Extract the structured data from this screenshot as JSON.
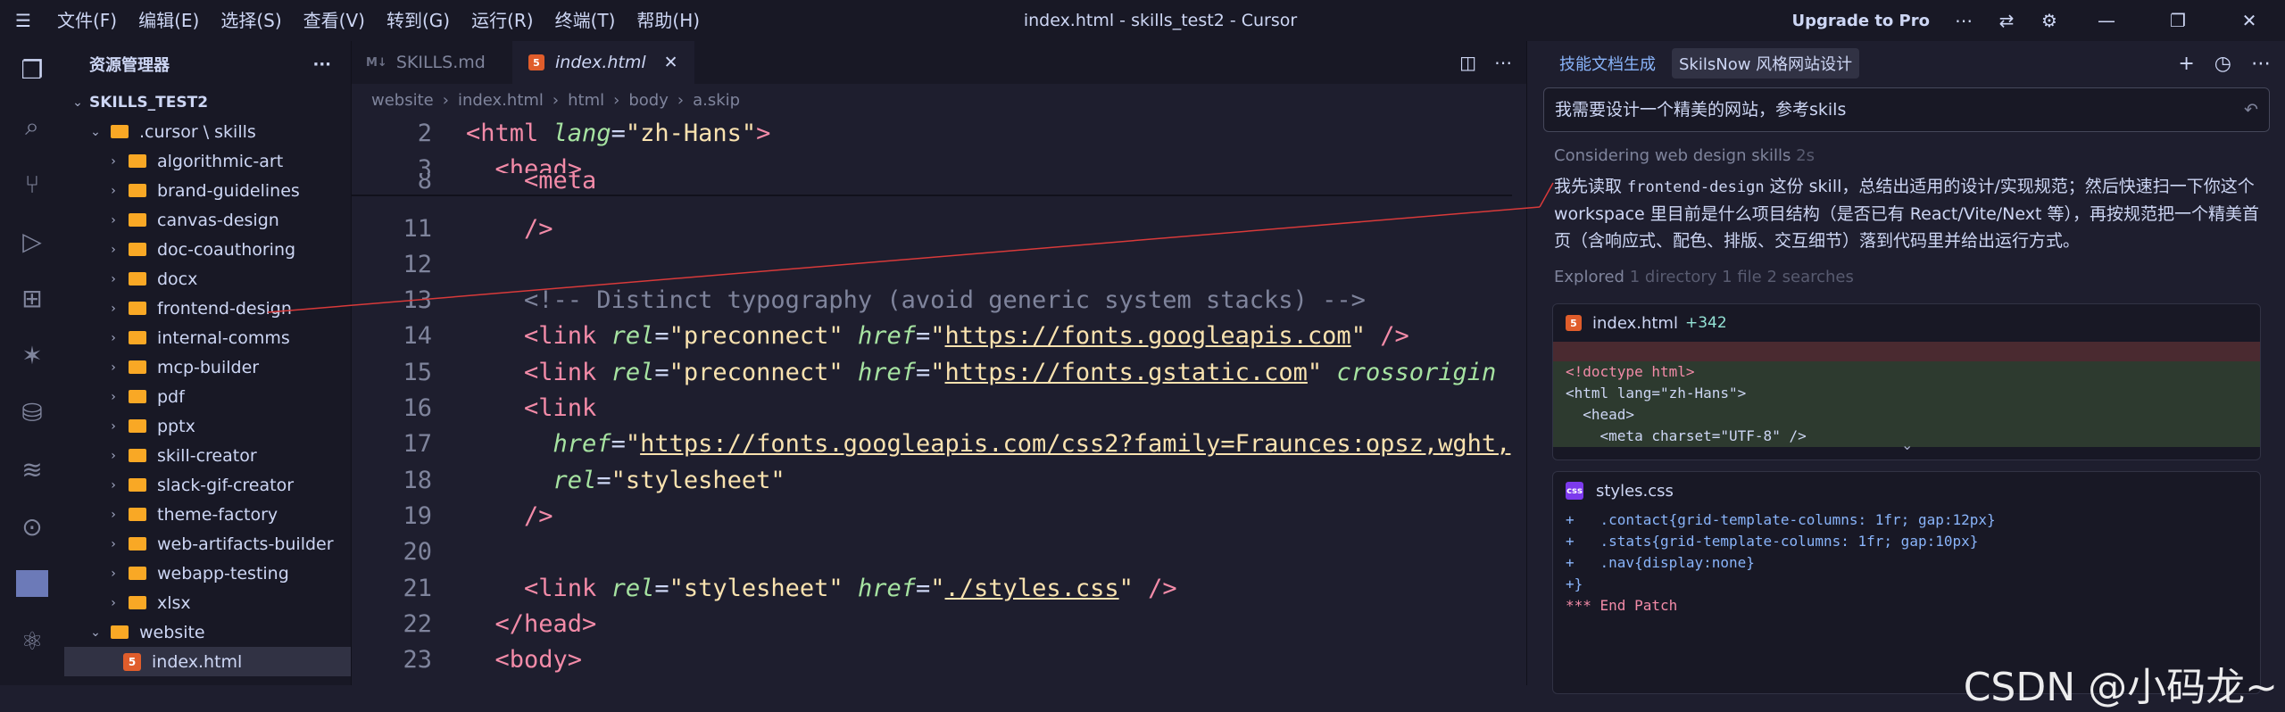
{
  "titlebar": {
    "menus": [
      "文件(F)",
      "编辑(E)",
      "选择(S)",
      "查看(V)",
      "转到(G)",
      "运行(R)",
      "终端(T)",
      "帮助(H)"
    ],
    "title": "index.html - skills_test2 - Cursor",
    "upgrade": "Upgrade to Pro"
  },
  "sidebar": {
    "title": "资源管理器",
    "more": "···",
    "root": "SKILLS_TEST2",
    "cursor_path": ".cursor \\ skills",
    "folders": [
      "algorithmic-art",
      "brand-guidelines",
      "canvas-design",
      "doc-coauthoring",
      "docx",
      "frontend-design",
      "internal-comms",
      "mcp-builder",
      "pdf",
      "pptx",
      "skill-creator",
      "slack-gif-creator",
      "theme-factory",
      "web-artifacts-builder",
      "webapp-testing",
      "xlsx"
    ],
    "website": "website",
    "file": "index.html"
  },
  "editor": {
    "tabs": [
      {
        "label": "SKILLS.md",
        "icon": "M↓"
      },
      {
        "label": "index.html",
        "icon": "5",
        "close": "✕"
      }
    ],
    "crumbs": [
      "website",
      "index.html",
      "html",
      "body",
      "a.skip"
    ],
    "lines": [
      {
        "n": "2",
        "html": "<span class='tg'>&lt;html</span> <span class='at'>lang</span><span class='pl'>=</span><span class='st'>\"zh-Hans\"</span><span class='tg'>&gt;</span>"
      },
      {
        "n": "3",
        "html": "  <span class='tg'>&lt;head&gt;</span>"
      },
      {
        "n": "11",
        "html": "    <span class='tg'>/&gt;</span>"
      },
      {
        "n": "12",
        "html": ""
      },
      {
        "n": "13",
        "html": "    <span class='cm'>&lt;!-- Distinct typography (avoid generic system stacks) --&gt;</span>"
      },
      {
        "n": "14",
        "html": "    <span class='tg'>&lt;link</span> <span class='at'>rel</span>=<span class='st'>\"preconnect\"</span> <span class='at'>href</span>=<span class='st'>\"<span class='ul'>https://fonts.googleapis.com</span>\"</span> <span class='tg'>/&gt;</span>"
      },
      {
        "n": "15",
        "html": "    <span class='tg'>&lt;link</span> <span class='at'>rel</span>=<span class='st'>\"preconnect\"</span> <span class='at'>href</span>=<span class='st'>\"<span class='ul'>https://fonts.gstatic.com</span>\"</span> <span class='at'>crossorigin</span>"
      },
      {
        "n": "16",
        "html": "    <span class='tg'>&lt;link</span>"
      },
      {
        "n": "17",
        "html": "      <span class='at'>href</span>=<span class='st'>\"<span class='ul'>https://fonts.googleapis.com/css2?family=Fraunces:opsz,wght,</span></span>"
      },
      {
        "n": "18",
        "html": "      <span class='at'>rel</span>=<span class='st'>\"stylesheet\"</span>"
      },
      {
        "n": "19",
        "html": "    <span class='tg'>/&gt;</span>"
      },
      {
        "n": "20",
        "html": ""
      },
      {
        "n": "21",
        "html": "    <span class='tg'>&lt;link</span> <span class='at'>rel</span>=<span class='st'>\"stylesheet\"</span> <span class='at'>href</span>=<span class='st'>\"<span class='ul'>./styles.css</span>\"</span> <span class='tg'>/&gt;</span>"
      },
      {
        "n": "22",
        "html": "  <span class='tg'>&lt;/head&gt;</span>"
      },
      {
        "n": "23",
        "html": "  <span class='tg'>&lt;body&gt;</span>"
      }
    ],
    "sticky_meta_n": "8",
    "sticky_meta": "    <meta"
  },
  "panel": {
    "tabs": [
      "技能文档生成",
      "SkilsNow 风格网站设计"
    ],
    "prompt": "我需要设计一个精美的网站，参考skils",
    "thinking": "Considering web design skills",
    "thinking_time": "2s",
    "message": "我先读取 <code>frontend-design</code> 这份 skill，总结出适用的设计/实现规范；然后快速扫一下你这个 workspace 里目前是什么项目结构（是否已有 React/Vite/Next 等），再按规范把一个精美首页（含响应式、配色、排版、交互细节）落到代码里并给出运行方式。",
    "explored": "Explored",
    "explored_detail": "1 directory 1 file 2 searches",
    "card1": {
      "name": "index.html",
      "delta": "+342",
      "lines": [
        "<!doctype html>",
        "<html lang=\"zh-Hans\">",
        "  <head>",
        "    <meta charset=\"UTF-8\" />"
      ]
    },
    "card2": {
      "name": "styles.css",
      "lines": [
        "+   .contact{grid-template-columns: 1fr; gap:12px}",
        "+   .stats{grid-template-columns: 1fr; gap:10px}",
        "+   .nav{display:none}",
        "+}",
        "*** End Patch"
      ]
    }
  },
  "watermark": "CSDN @小码龙~"
}
